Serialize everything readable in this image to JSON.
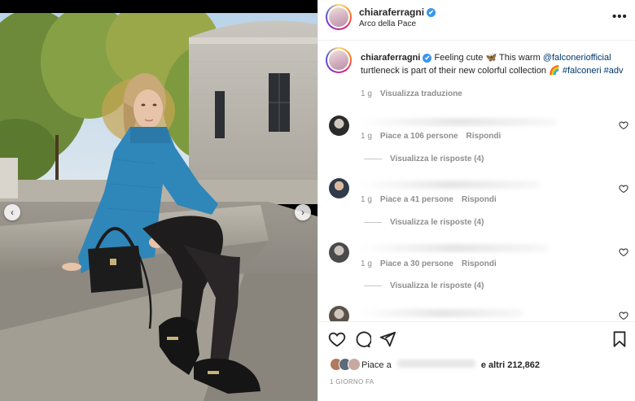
{
  "post": {
    "username": "chiaraferragni",
    "verified_symbol": "✔",
    "location": "Arco della Pace",
    "more_symbol": "•••"
  },
  "caption": {
    "username": "chiaraferragni",
    "text_1": " Feeling cute 🦋 This warm ",
    "mention": "@falconeriofficial",
    "text_2": " turtleneck is part of their new colorful collection 🌈 ",
    "hashtag_1": "#falconeri",
    "hashtag_2": "#adv",
    "time": "1 g",
    "translate_label": "Visualizza traduzione"
  },
  "comments": [
    {
      "time": "1 g",
      "likes": "Piace a 106 persone",
      "reply_label": "Rispondi",
      "replies_label": "Visualizza le risposte (4)"
    },
    {
      "time": "1 g",
      "likes": "Piace a 41 persone",
      "reply_label": "Rispondi",
      "replies_label": "Visualizza le risposte (4)"
    },
    {
      "time": "1 g",
      "likes": "Piace a 30 persone",
      "reply_label": "Rispondi",
      "replies_label": "Visualizza le risposte (4)"
    }
  ],
  "likes": {
    "prefix": "Piace a",
    "suffix": "e altri",
    "count": "212,862"
  },
  "time_ago": "1 GIORNO FA",
  "nav": {
    "prev_symbol": "‹",
    "next_symbol": "›"
  },
  "icons": {
    "like": "heart-icon",
    "comment": "comment-icon",
    "share": "paper-plane-icon",
    "save": "bookmark-icon",
    "more": "more-icon"
  },
  "colors": {
    "link": "#00376b",
    "verified": "#3897f0",
    "meta_gray": "#8e8e8e",
    "text": "#262626"
  }
}
